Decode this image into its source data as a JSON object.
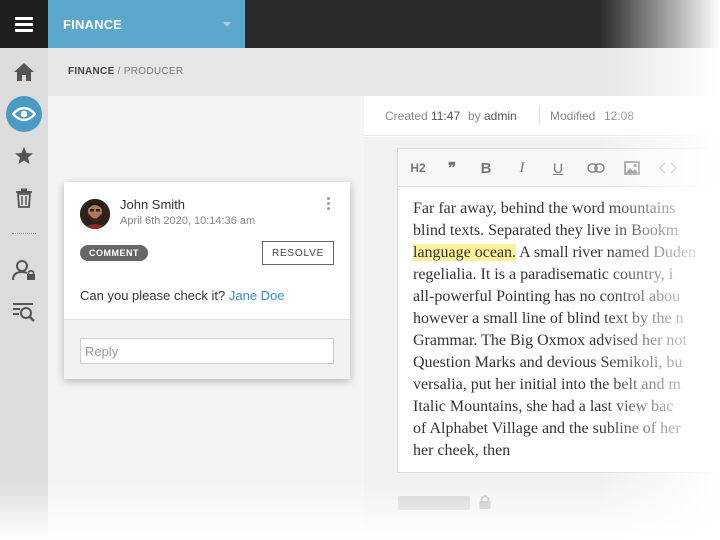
{
  "topbar": {
    "project": "FINANCE"
  },
  "breadcrumb": {
    "root": "FINANCE",
    "separator": " / ",
    "current": "PRODUCER"
  },
  "sidebar": {
    "items": [
      {
        "icon": "home-icon"
      },
      {
        "icon": "eye-icon",
        "active": true
      },
      {
        "icon": "star-icon"
      },
      {
        "icon": "trash-icon"
      },
      {
        "icon": "user-lock-icon"
      },
      {
        "icon": "search-list-icon"
      }
    ]
  },
  "meta": {
    "created_label": "Created",
    "created_time": "11:47",
    "by_label": "by",
    "author": "admin",
    "modified_label": "Modified",
    "modified_time": "12:08"
  },
  "toolbar": {
    "h2": "H2",
    "quote": "❞",
    "bold": "B",
    "italic": "I",
    "underline": "U"
  },
  "editor": {
    "lines": [
      "Far far away, behind the word mountains",
      "blind texts. Separated they live in Bookm",
      "",
      "regelialia. It is a paradisematic country, i",
      "all-powerful Pointing has no control abou",
      "however a small line of blind text by the n",
      "Grammar. The Big Oxmox advised her not",
      "Question Marks and devious Semikoli, bu",
      "versalia, put her initial into the belt and m",
      "Italic Mountains, she had a last view bac",
      "of Alphabet Village and the subline of her",
      "her cheek, then"
    ],
    "highlight": "language ocean.",
    "line3_rest": " A small river named Duden"
  },
  "comment": {
    "author": "John Smith",
    "date": "April 6th 2020, 10:14:36 am",
    "tag": "COMMENT",
    "resolve_label": "RESOLVE",
    "text": "Can you please check it? ",
    "mention": "Jane Doe",
    "reply_placeholder": "Reply"
  },
  "colors": {
    "accent": "#5ca8cc",
    "active_icon": "#4a9ac4",
    "highlight": "#fdf299",
    "mention": "#3a8bbf"
  }
}
